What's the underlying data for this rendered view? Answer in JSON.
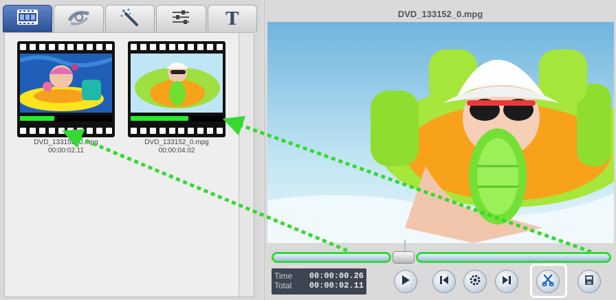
{
  "library": {
    "tabs": [
      {
        "name": "tab-video",
        "icon": "filmstrip-icon",
        "active": true
      },
      {
        "name": "tab-effects",
        "icon": "film-reel-icon",
        "active": false
      },
      {
        "name": "tab-magic",
        "icon": "magic-wand-icon",
        "active": false
      },
      {
        "name": "tab-adjust",
        "icon": "sliders-icon",
        "active": false
      },
      {
        "name": "tab-text",
        "icon": "text-icon",
        "glyph": "T",
        "active": false
      }
    ],
    "clips": [
      {
        "name": "DVD_133152_0.mpg",
        "duration": "00:00:02.11",
        "progress": 0.37
      },
      {
        "name": "DVD_133152_0.mpg",
        "duration": "00:00:04.02",
        "progress": 0.63
      }
    ]
  },
  "player": {
    "title": "DVD_133152_0.mpg",
    "time_label": "Time",
    "total_label": "Total",
    "time_value": "00:00:00.26",
    "total_value": "00:00:02.11",
    "position_fraction": 0.37,
    "controls": [
      "play-icon",
      "previous-frame-icon",
      "settings-gear-icon",
      "next-frame-icon",
      "scissors-icon",
      "save-icon"
    ]
  },
  "colors": {
    "accent_green": "#22ee22",
    "annotation_green": "#34d934",
    "active_tab": "#3a5ea6",
    "time_box": "#3c4551"
  }
}
